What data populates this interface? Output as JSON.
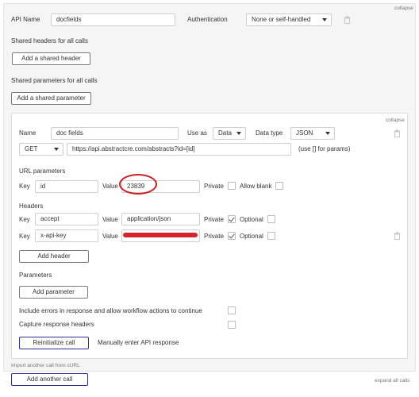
{
  "call": {
    "api_name_label": "API Name",
    "api_name_value": "docfields",
    "authentication_label": "Authentication",
    "authentication_value": "None or self-handled",
    "collapse_label": "collapse",
    "shared_headers_label": "Shared headers for all calls",
    "add_shared_header": "Add a shared header",
    "shared_params_label": "Shared parameters for all calls",
    "add_shared_parameter": "Add a shared parameter"
  },
  "inner": {
    "collapse_label": "collapse",
    "name_label": "Name",
    "name_value": "doc fields",
    "use_as_label": "Use as",
    "use_as_value": "Data",
    "data_type_label": "Data type",
    "data_type_value": "JSON",
    "method_value": "GET",
    "url_value": "https://api.abstractcre.com/abstracts?id=[id]",
    "url_hint": "(use [] for params)",
    "url_params_label": "URL parameters",
    "url_param": {
      "key_label": "Key",
      "key_value": "id",
      "value_label": "Value",
      "value_value": "23839",
      "private_label": "Private",
      "allow_blank_label": "Allow blank"
    },
    "headers_label": "Headers",
    "headers": [
      {
        "key_label": "Key",
        "key_value": "accept",
        "value_label": "Value",
        "value_value": "application/json",
        "private_label": "Private",
        "private_checked": true,
        "optional_label": "Optional"
      },
      {
        "key_label": "Key",
        "key_value": "x-api-key",
        "value_label": "Value",
        "value_value": "",
        "private_label": "Private",
        "private_checked": true,
        "optional_label": "Optional"
      }
    ],
    "add_header": "Add header",
    "parameters_label": "Parameters",
    "add_parameter": "Add parameter",
    "include_errors_label": "Include errors in response and allow workflow actions to continue",
    "capture_headers_label": "Capture response headers",
    "reinitialize": "Reinitialize call",
    "manual_entry": "Manually enter API response"
  },
  "footer": {
    "import_curl": "Import another call from cURL",
    "add_another_call": "Add another call",
    "expand_all": "expand all calls"
  },
  "colors": {
    "annotation_red": "#cc1f28",
    "button_border_blue": "#2d2f8a"
  }
}
